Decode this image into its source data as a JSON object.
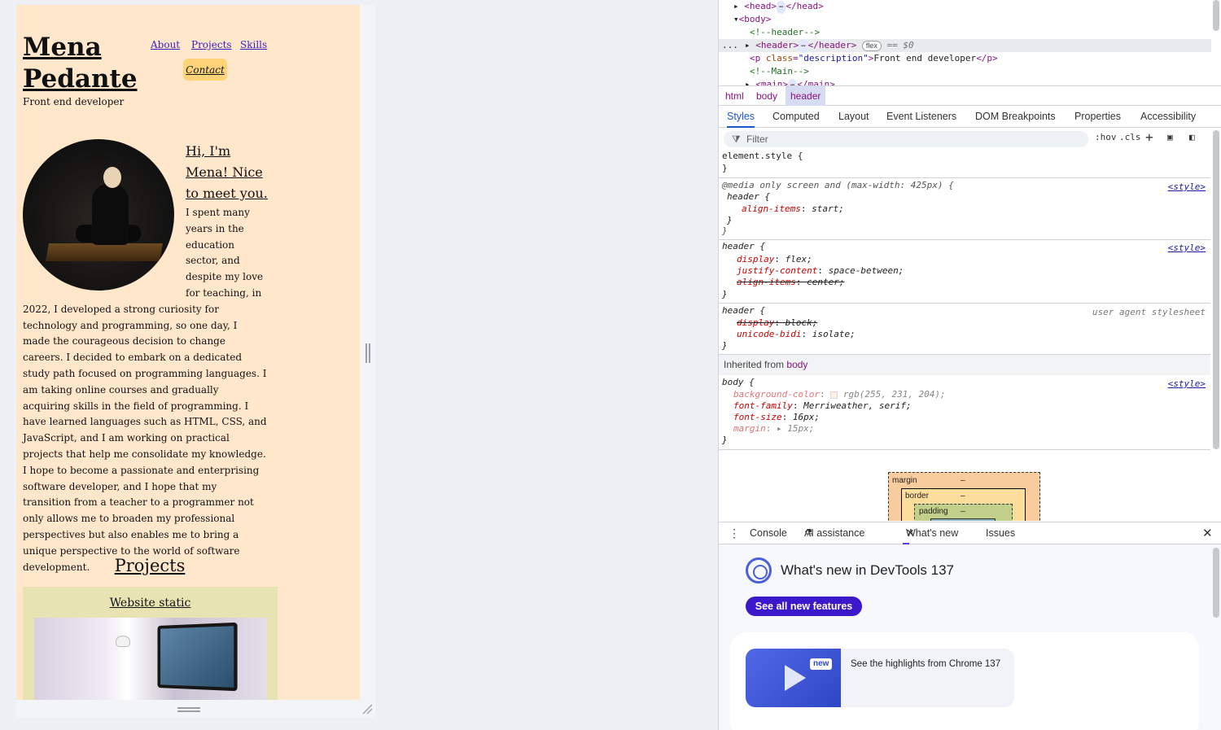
{
  "page": {
    "site_title": "Mena Pedante",
    "description": "Front end developer",
    "nav": [
      "About",
      "Projects",
      "Skills"
    ],
    "contact": "Contact",
    "hi_heading": "Hi, I'm Mena! Nice to meet you.",
    "about_text": "I spent many years in the education sector, and despite my love for teaching, in 2022, I developed a strong curiosity for technology and programming, so one day, I made the courageous decision to change careers. I decided to embark on a dedicated study path focused on programming languages. I am taking online courses and gradually acquiring skills in the field of programming. I have learned languages such as HTML, CSS, and JavaScript, and I am working on practical projects that help me consolidate my knowledge. I hope to become a passionate and enterprising software developer, and I hope that my transition from a teacher to a programmer not only allows me to broaden my professional perspectives but also enables me to bring a unique perspective to the world of software development.",
    "projects_heading": "Projects",
    "project_title": "Website static"
  },
  "devtools": {
    "dom": {
      "head_open": "<head>",
      "head_close": "</head>",
      "body": "<body>",
      "comment_header": "<!--header-->",
      "header_open": "<header>",
      "header_close": "</header>",
      "flex_badge": "flex",
      "eq": "== $0",
      "p_open": "<p ",
      "p_attr": "class",
      "p_val": "\"description\"",
      "p_text": "Front end developer",
      "p_close": "</p>",
      "comment_main": "<!--Main-->",
      "main_open": "<main>",
      "main_close": "</main>",
      "ellipsis": "..."
    },
    "breadcrumbs": [
      "html",
      "body",
      "header"
    ],
    "tabs": [
      "Styles",
      "Computed",
      "Layout",
      "Event Listeners",
      "DOM Breakpoints",
      "Properties",
      "Accessibility"
    ],
    "filter_placeholder": "Filter",
    "filter_buttons": [
      ":hov",
      ".cls",
      "+"
    ],
    "styles": {
      "element_style": "element.style {",
      "close_brace": "}",
      "media_query": "@media only screen and (max-width: 425px) {",
      "header_sel": "header {",
      "align_items_start": "align-items",
      "align_items_start_val": "start;",
      "display": "display",
      "display_flex_val": "flex;",
      "justify": "justify-content",
      "justify_val": "space-between;",
      "align_items": "align-items",
      "align_center_val": "center;",
      "display_block_val": "block;",
      "unicode": "unicode-bidi",
      "unicode_val": "isolate;",
      "ua_label": "user agent stylesheet",
      "source": "<style>",
      "inherited_label": "Inherited from",
      "inherited_tag": "body",
      "body_sel": "body {",
      "bg": "background-color",
      "bg_val": "rgb(255, 231, 204);",
      "ff": "font-family",
      "ff_val": "Merriweather, serif;",
      "fs": "font-size",
      "fs_val": "16px;",
      "margin": "margin",
      "margin_val": "15px;"
    },
    "box_model": {
      "margin": "margin",
      "border": "border",
      "padding": "padding",
      "dash": "–"
    },
    "drawer_tabs": [
      "Console",
      "AI assistance",
      "What's new",
      "Issues"
    ],
    "whats_new": {
      "title": "What's new in DevTools 137",
      "button": "See all new features",
      "badge": "new",
      "item": "See the highlights from Chrome 137"
    }
  },
  "colors": {
    "page_bg": "#ffe7cc",
    "contact_bg": "#ffd479",
    "project_card_bg": "#e7e3b3",
    "link": "#3a1ec0",
    "devtools_accent": "#1a57c8",
    "button_bg": "#3b18c9"
  }
}
